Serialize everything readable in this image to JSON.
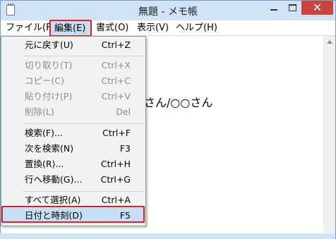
{
  "window": {
    "title": "無題 - メモ帳",
    "close_glyph": "✕"
  },
  "menubar": {
    "file": "ファイル(F)",
    "edit": "編集(E)",
    "format": "書式(O)",
    "view": "表示(V)",
    "help": "ヘルプ(H)"
  },
  "document": {
    "visible_text": "さん/○○さん"
  },
  "edit_menu": {
    "items": [
      {
        "label": "元に戻す(U)",
        "shortcut": "Ctrl+Z",
        "enabled": true
      },
      {
        "label": "切り取り(T)",
        "shortcut": "Ctrl+X",
        "enabled": false
      },
      {
        "label": "コピー(C)",
        "shortcut": "Ctrl+C",
        "enabled": false
      },
      {
        "label": "貼り付け(P)",
        "shortcut": "Ctrl+V",
        "enabled": false
      },
      {
        "label": "削除(L)",
        "shortcut": "Del",
        "enabled": false
      },
      {
        "label": "検索(F)...",
        "shortcut": "Ctrl+F",
        "enabled": true
      },
      {
        "label": "次を検索(N)",
        "shortcut": "F3",
        "enabled": true
      },
      {
        "label": "置換(R)...",
        "shortcut": "Ctrl+H",
        "enabled": true
      },
      {
        "label": "行へ移動(G)...",
        "shortcut": "Ctrl+G",
        "enabled": true
      },
      {
        "label": "すべて選択(A)",
        "shortcut": "Ctrl+A",
        "enabled": true
      },
      {
        "label": "日付と時刻(D)",
        "shortcut": "F5",
        "enabled": true
      }
    ]
  },
  "colors": {
    "highlight_border": "#e02020",
    "selected_bg": "#c5dff5",
    "close_button": "#c7453b"
  }
}
